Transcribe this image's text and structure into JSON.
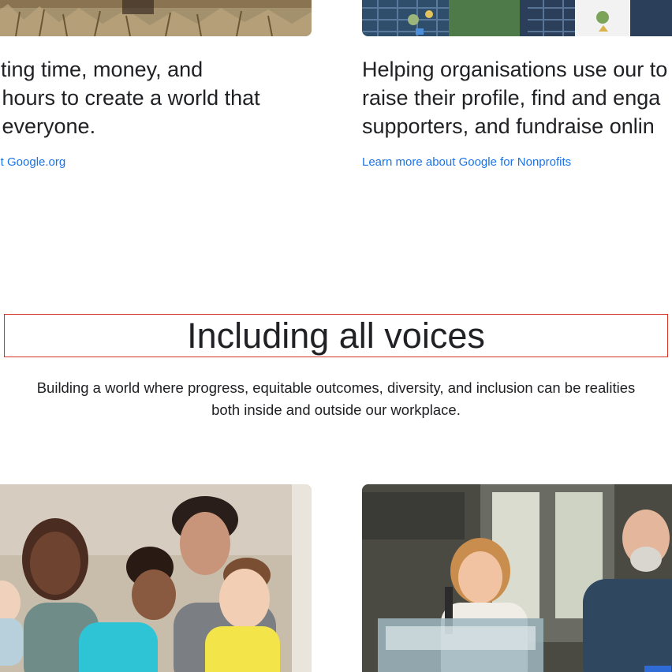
{
  "cards_top": [
    {
      "description_lines": [
        "uting time, money, and",
        "r hours to create a world that",
        "r everyone."
      ],
      "link_label": "out Google.org",
      "image_icon": "photo-outdoor-field"
    },
    {
      "description_lines": [
        "Helping organisations use our to",
        "raise their profile, find and enga",
        "supporters, and fundraise onlin"
      ],
      "link_label": "Learn more about Google for Nonprofits",
      "image_icon": "photo-uniformed-youth"
    }
  ],
  "section": {
    "title": "Including all voices",
    "subtitle_lines": [
      "Building a world where progress, equitable outcomes, diversity, and inclusion can be realities",
      "both inside and outside our workplace."
    ]
  },
  "cards_bottom": [
    {
      "image_icon": "photo-family"
    },
    {
      "image_icon": "photo-accessibility-workspace"
    }
  ],
  "colors": {
    "link": "#1a73e8",
    "text": "#202124",
    "highlight_border": "#d93025"
  }
}
